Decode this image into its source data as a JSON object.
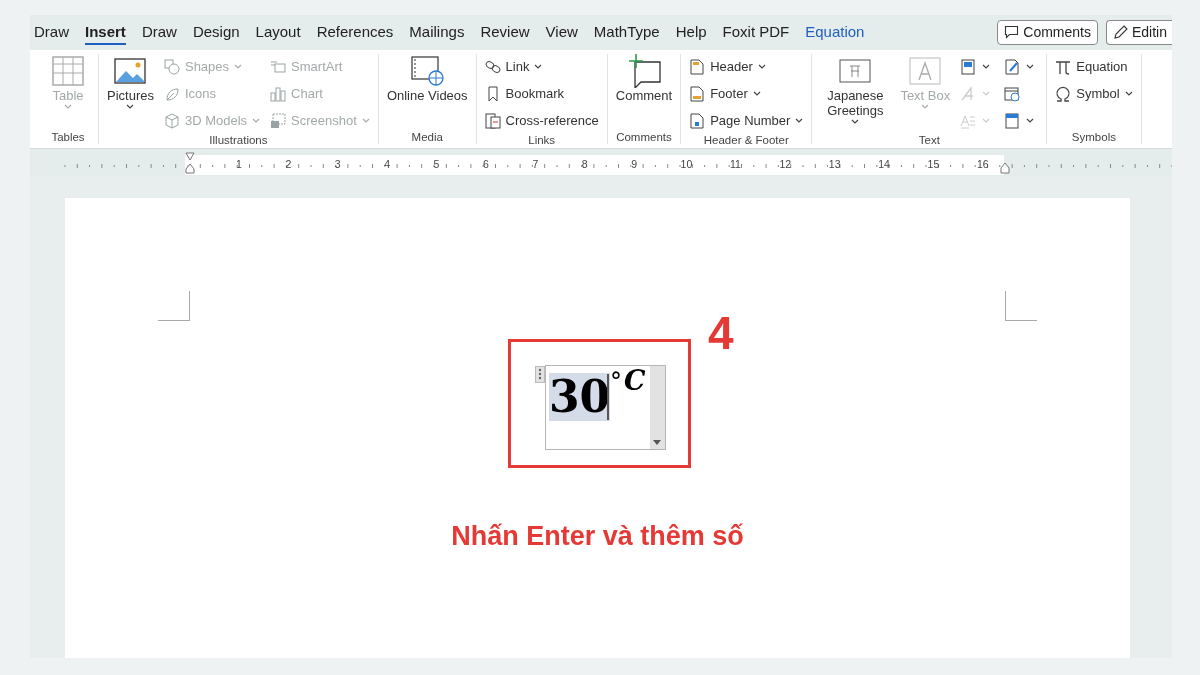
{
  "tabs": [
    {
      "label": "Draw",
      "selected": false,
      "kind": "normal"
    },
    {
      "label": "Insert",
      "selected": true,
      "kind": "normal"
    },
    {
      "label": "Draw",
      "selected": false,
      "kind": "normal"
    },
    {
      "label": "Design",
      "selected": false,
      "kind": "normal"
    },
    {
      "label": "Layout",
      "selected": false,
      "kind": "normal"
    },
    {
      "label": "References",
      "selected": false,
      "kind": "normal"
    },
    {
      "label": "Mailings",
      "selected": false,
      "kind": "normal"
    },
    {
      "label": "Review",
      "selected": false,
      "kind": "normal"
    },
    {
      "label": "View",
      "selected": false,
      "kind": "normal"
    },
    {
      "label": "MathType",
      "selected": false,
      "kind": "normal"
    },
    {
      "label": "Help",
      "selected": false,
      "kind": "normal"
    },
    {
      "label": "Foxit PDF",
      "selected": false,
      "kind": "normal"
    },
    {
      "label": "Equation",
      "selected": false,
      "kind": "contextual"
    }
  ],
  "header_buttons": [
    {
      "label": "Comments"
    },
    {
      "label": "Editin"
    }
  ],
  "ribbon": [
    {
      "label": "Tables",
      "columns": [
        [
          {
            "kind": "large",
            "label": "Table",
            "disabled": true,
            "dropdown": true
          }
        ]
      ]
    },
    {
      "label": "Illustrations",
      "columns": [
        [
          {
            "kind": "large",
            "label": "Pictures",
            "disabled": false,
            "dropdown": true
          }
        ],
        [
          {
            "kind": "small",
            "label": "Shapes",
            "disabled": true,
            "dropdown": true
          },
          {
            "kind": "small",
            "label": "Icons",
            "disabled": true,
            "dropdown": false
          },
          {
            "kind": "small",
            "label": "3D Models",
            "disabled": true,
            "dropdown": true
          }
        ],
        [
          {
            "kind": "small",
            "label": "SmartArt",
            "disabled": true,
            "dropdown": false
          },
          {
            "kind": "small",
            "label": "Chart",
            "disabled": true,
            "dropdown": false
          },
          {
            "kind": "small",
            "label": "Screenshot",
            "disabled": true,
            "dropdown": true
          }
        ]
      ]
    },
    {
      "label": "Media",
      "columns": [
        [
          {
            "kind": "large",
            "label": "Online Videos",
            "disabled": false,
            "dropdown": false
          }
        ]
      ]
    },
    {
      "label": "Links",
      "columns": [
        [
          {
            "kind": "small",
            "label": "Link",
            "disabled": false,
            "dropdown": true
          },
          {
            "kind": "small",
            "label": "Bookmark",
            "disabled": false,
            "dropdown": false
          },
          {
            "kind": "small",
            "label": "Cross-reference",
            "disabled": false,
            "dropdown": false
          }
        ]
      ]
    },
    {
      "label": "Comments",
      "columns": [
        [
          {
            "kind": "large",
            "label": "Comment",
            "disabled": false,
            "dropdown": false
          }
        ]
      ]
    },
    {
      "label": "Header & Footer",
      "columns": [
        [
          {
            "kind": "small",
            "label": "Header",
            "disabled": false,
            "dropdown": true
          },
          {
            "kind": "small",
            "label": "Footer",
            "disabled": false,
            "dropdown": true
          },
          {
            "kind": "small",
            "label": "Page Number",
            "disabled": false,
            "dropdown": true
          }
        ]
      ]
    },
    {
      "label": "Text",
      "columns": [
        [
          {
            "kind": "large",
            "label": "Japanese Greetings",
            "disabled": false,
            "dropdown": true
          }
        ],
        [
          {
            "kind": "large",
            "label": "Text Box",
            "disabled": true,
            "dropdown": true
          }
        ],
        [
          {
            "kind": "icon",
            "disabled": false,
            "dropdown": true
          },
          {
            "kind": "icon",
            "disabled": true,
            "dropdown": true
          },
          {
            "kind": "icon",
            "disabled": true,
            "dropdown": true
          }
        ],
        [
          {
            "kind": "icon",
            "disabled": false,
            "dropdown": true
          },
          {
            "kind": "icon",
            "disabled": false,
            "dropdown": false
          },
          {
            "kind": "icon",
            "disabled": false,
            "dropdown": true
          }
        ]
      ]
    },
    {
      "label": "Symbols",
      "columns": [
        [
          {
            "kind": "small",
            "label": "Equation",
            "disabled": false,
            "dropdown": false
          },
          {
            "kind": "small",
            "label": "Symbol",
            "disabled": false,
            "dropdown": true
          }
        ]
      ]
    }
  ],
  "ruler": {
    "numbers": [
      "1",
      "2",
      "3",
      "4",
      "5",
      "6",
      "7",
      "8",
      "9",
      "10",
      "11",
      "12",
      "13",
      "14",
      "15",
      "16"
    ]
  },
  "document": {
    "equation": {
      "number": "30",
      "degree": "°",
      "unit": "C"
    },
    "step_number": "4",
    "caption": "Nhấn Enter và thêm số"
  }
}
